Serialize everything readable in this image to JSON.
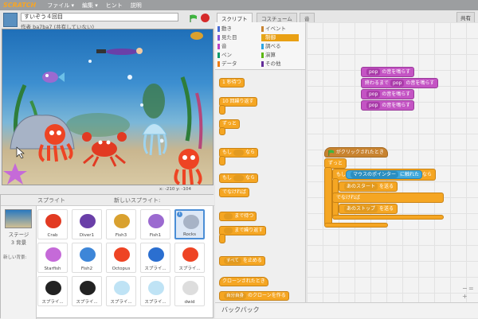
{
  "menubar": {
    "logo": "SCRATCH",
    "items": [
      "ファイル ▾",
      "編集 ▾",
      "ヒント",
      "説明"
    ]
  },
  "project": {
    "title": "すいぞう４回目",
    "author": "作者 ba7ba7 (共有していない)"
  },
  "stage": {
    "coords": "x: -210  y: -104"
  },
  "sprites_panel": {
    "title": "スプライト",
    "new_sprite": "新しいスプライト:",
    "stage_label": "ステージ",
    "stage_sub": "3 背景",
    "new_backdrop": "新しい背景:",
    "sprites": [
      {
        "name": "Crab"
      },
      {
        "name": "Diver1"
      },
      {
        "name": "Fish3"
      },
      {
        "name": "Fish1"
      },
      {
        "name": "Rocks",
        "selected": true
      },
      {
        "name": "Starfish"
      },
      {
        "name": "Fish2"
      },
      {
        "name": "Octopus"
      },
      {
        "name": "スプライ..."
      },
      {
        "name": "スプライ..."
      },
      {
        "name": "スプライ..."
      },
      {
        "name": "スプライ..."
      },
      {
        "name": "スプライ..."
      },
      {
        "name": "スプライ..."
      },
      {
        "name": "dwid"
      }
    ]
  },
  "tabs": {
    "scripts": "スクリプト",
    "costumes": "コスチューム",
    "sounds": "音",
    "share": "共有"
  },
  "categories": {
    "left": [
      "動き",
      "見た目",
      "音",
      "ペン",
      "データ"
    ],
    "right": [
      "イベント",
      "制御",
      "調べる",
      "演算",
      "その他"
    ],
    "colors": {
      "motion": "#4a6cd4",
      "looks": "#8a55d7",
      "sound": "#bb42c3",
      "pen": "#0e9a6c",
      "data": "#ee7d16",
      "events": "#c88330",
      "control": "#e1a91a",
      "sensing": "#2ca5e2",
      "operators": "#5cb712",
      "more": "#632d99"
    }
  },
  "palette": {
    "wait": "1 秒待つ",
    "repeat": "10 回繰り返す",
    "forever": "ずっと",
    "if_then": "もし",
    "then": "なら",
    "if_else_if": "もし",
    "if_else_then": "なら",
    "else": "でなければ",
    "wait_until": "まで待つ",
    "repeat_until": "まで繰り返す",
    "stop_all": "すべて",
    "stop_suffix": "を止める",
    "when_clone": "クローンされたとき",
    "create_clone_prefix": "自分自身",
    "create_clone_suffix": "のクローンを作る"
  },
  "script": {
    "sound_blocks": [
      {
        "slot": "pop",
        "text": "の音を鳴らす",
        "prefix": ""
      },
      {
        "slot": "pop",
        "text": "の音を鳴らす",
        "prefix": "終わるまで"
      },
      {
        "slot": "pop",
        "text": "の音を鳴らす",
        "prefix": ""
      },
      {
        "slot": "pop",
        "text": "の音を鳴らす",
        "prefix": ""
      }
    ],
    "hat": "がクリックされたとき",
    "forever": "ずっと",
    "if_label": "もし",
    "then_label": "なら",
    "sense_slot": "マウスのポインター",
    "sense_text": "に触れた",
    "backdrop1_slot": "あのスタート",
    "backdrop_text": "を送る",
    "else_label": "でなければ",
    "backdrop2_slot": "あのストップ"
  },
  "backpack": "バックパック"
}
